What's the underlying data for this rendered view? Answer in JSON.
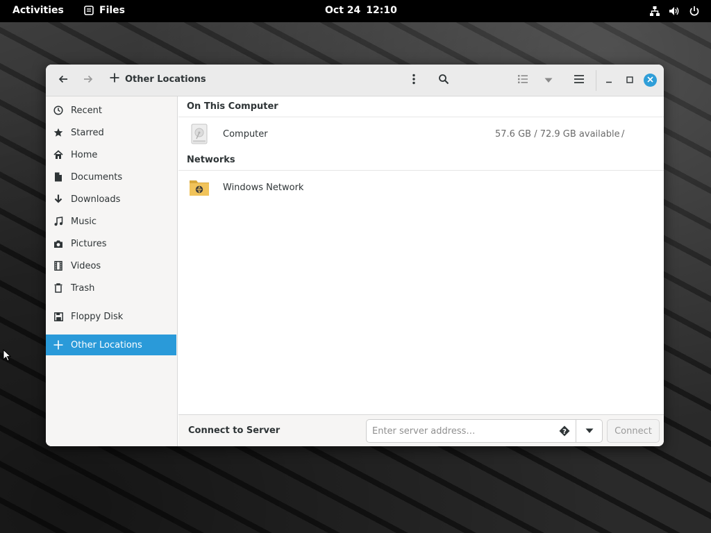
{
  "topbar": {
    "activities": "Activities",
    "app_name": "Files",
    "date": "Oct 24",
    "time": "12:10",
    "icons": [
      "files-app-icon",
      "network-icon",
      "volume-icon",
      "power-icon"
    ]
  },
  "window": {
    "path_label": "Other Locations",
    "accent_color": "#2a9ad9",
    "headerbar_icons": [
      "back-icon",
      "forward-icon",
      "new-location-icon",
      "kebab-menu-icon",
      "search-icon",
      "list-view-icon",
      "view-options-icon",
      "hamburger-menu-icon",
      "minimize-icon",
      "maximize-icon",
      "close-icon"
    ]
  },
  "sidebar": {
    "items": [
      {
        "label": "Recent",
        "icon": "clock-icon"
      },
      {
        "label": "Starred",
        "icon": "star-icon"
      },
      {
        "label": "Home",
        "icon": "home-icon"
      },
      {
        "label": "Documents",
        "icon": "document-icon"
      },
      {
        "label": "Downloads",
        "icon": "download-icon"
      },
      {
        "label": "Music",
        "icon": "music-icon"
      },
      {
        "label": "Pictures",
        "icon": "camera-icon"
      },
      {
        "label": "Videos",
        "icon": "film-icon"
      },
      {
        "label": "Trash",
        "icon": "trash-icon"
      },
      {
        "label": "Floppy Disk",
        "icon": "floppy-icon"
      },
      {
        "label": "Other Locations",
        "icon": "plus-icon",
        "active": true
      }
    ]
  },
  "main": {
    "sections": [
      {
        "header": "On This Computer",
        "rows": [
          {
            "name": "Computer",
            "available": "57.6 GB / 72.9 GB available",
            "mount": "/",
            "icon": "drive-icon"
          }
        ]
      },
      {
        "header": "Networks",
        "rows": [
          {
            "name": "Windows Network",
            "icon": "network-folder-icon"
          }
        ]
      }
    ]
  },
  "connect": {
    "label": "Connect to Server",
    "placeholder": "Enter server address…",
    "button": "Connect"
  }
}
